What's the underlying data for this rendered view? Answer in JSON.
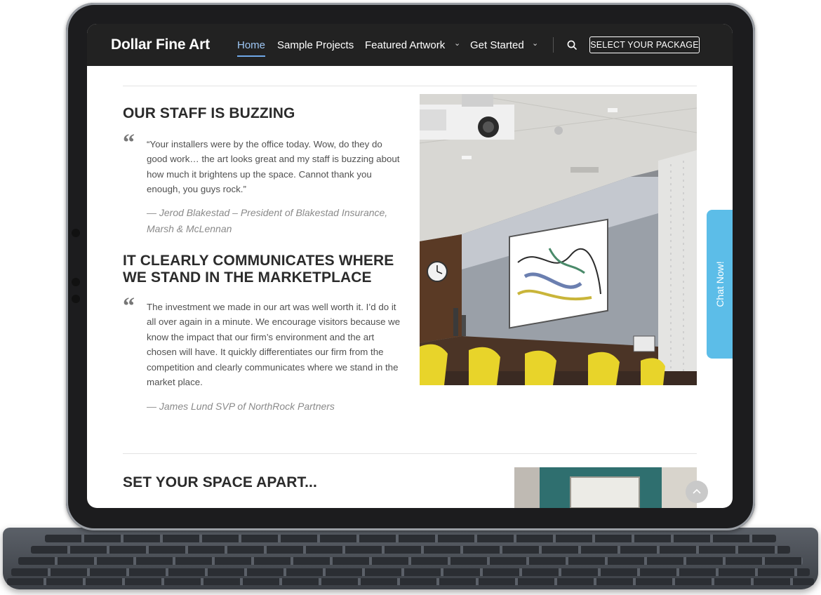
{
  "header": {
    "logo": "Dollar Fine Art",
    "nav": [
      {
        "label": "Home",
        "active": true
      },
      {
        "label": "Sample Projects"
      },
      {
        "label": "Featured Artwork",
        "has_dropdown": true
      },
      {
        "label": "Get Started",
        "has_dropdown": true
      }
    ],
    "search_icon": "search-icon",
    "cta_label": "SELECT YOUR PACKAGE"
  },
  "sections": [
    {
      "heading": "OUR STAFF IS BUZZING",
      "quote": "“Your installers were by the office today. Wow, do they do good work… the art looks great and my staff is buzzing about how much it brightens up the space. Cannot thank you enough, you guys rock.”",
      "citation": "— Jerod Blakestad – President of Blakestad Insurance, Marsh & McLennan"
    },
    {
      "heading": "IT CLEARLY COMMUNICATES WHERE WE STAND IN THE MARKETPLACE",
      "quote": "The investment we made in our art was well worth it. I’d do it all over again in a minute. We encourage visitors because we know the impact that our firm’s environment and the art chosen will have. It quickly differentiates our firm from the competition and clearly communicates where we stand in the market place.",
      "citation": "— James Lund SVP of NorthRock Partners"
    },
    {
      "heading": "SET YOUR SPACE APART..."
    }
  ],
  "quote_mark": "“",
  "chat_label": "Chat Now!",
  "scroll_top_icon": "chevron-up-icon",
  "colors": {
    "header_bg": "#222222",
    "nav_active": "#9ec7f5",
    "chat_button": "#5cbde8",
    "heading": "#2b2b2b"
  }
}
